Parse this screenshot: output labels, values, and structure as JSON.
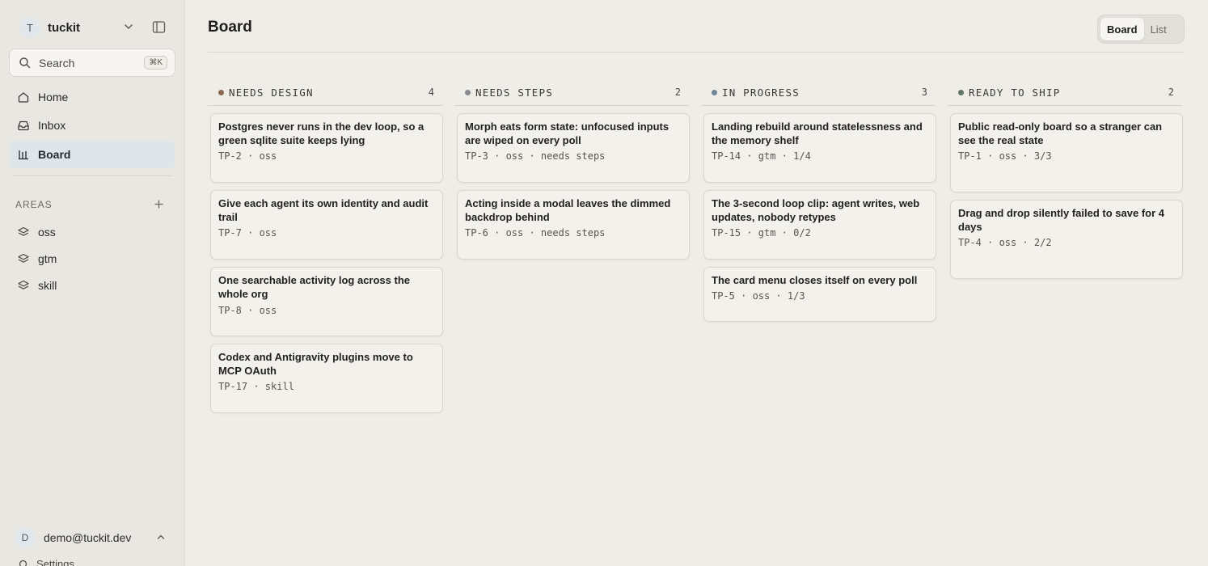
{
  "sidebar": {
    "workspace": {
      "initial": "T",
      "name": "tuckit"
    },
    "search": {
      "label": "Search",
      "shortcut": "⌘K"
    },
    "nav": [
      {
        "label": "Home",
        "icon": "home-icon"
      },
      {
        "label": "Inbox",
        "icon": "inbox-icon"
      },
      {
        "label": "Board",
        "icon": "board-icon",
        "active": true
      }
    ],
    "areas": {
      "label": "AREAS",
      "items": [
        {
          "label": "oss",
          "icon": "layers-icon"
        },
        {
          "label": "gtm",
          "icon": "layers-icon"
        },
        {
          "label": "skill",
          "icon": "layers-icon"
        }
      ]
    },
    "user": {
      "initial": "D",
      "email": "demo@tuckit.dev"
    },
    "settings_label": "Settings"
  },
  "header": {
    "title": "Board",
    "views": [
      {
        "label": "Board",
        "active": true
      },
      {
        "label": "List",
        "active": false
      }
    ]
  },
  "colors": {
    "needs_design": "#8a6a50",
    "needs_steps": "#8b8a93",
    "in_progress": "#6e8595",
    "ready_to_ship": "#5f7266",
    "active_nav": "#dfe6ea"
  },
  "columns": [
    {
      "title": "NEEDS DESIGN",
      "count": "4",
      "cards": [
        {
          "title": "Postgres never runs in the dev loop, so a green sqlite suite keeps lying",
          "meta": "TP-2 · oss"
        },
        {
          "title": "Give each agent its own identity and audit trail",
          "meta": "TP-7 · oss"
        },
        {
          "title": "One searchable activity log across the whole org",
          "meta": "TP-8 · oss"
        },
        {
          "title": "Codex and Antigravity plugins move to MCP OAuth",
          "meta": "TP-17 · skill"
        }
      ]
    },
    {
      "title": "NEEDS STEPS",
      "count": "2",
      "cards": [
        {
          "title": "Morph eats form state: unfocused inputs are wiped on every poll",
          "meta": "TP-3 · oss · needs steps"
        },
        {
          "title": "Acting inside a modal leaves the dimmed backdrop behind",
          "meta": "TP-6 · oss · needs steps"
        }
      ]
    },
    {
      "title": "IN PROGRESS",
      "count": "3",
      "cards": [
        {
          "title": "Landing rebuild around statelessness and the memory shelf",
          "meta": "TP-14 · gtm · 1/4"
        },
        {
          "title": "The 3-second loop clip: agent writes, web updates, nobody retypes",
          "meta": "TP-15 · gtm · 0/2"
        },
        {
          "title": "The card menu closes itself on every poll",
          "meta": "TP-5 · oss · 1/3"
        }
      ]
    },
    {
      "title": "READY TO SHIP",
      "count": "2",
      "cards": [
        {
          "title": "Public read-only board so a stranger can see the real state",
          "meta": "TP-1 · oss · 3/3"
        },
        {
          "title": "Drag and drop silently failed to save for 4 days",
          "meta": "TP-4 · oss · 2/2"
        }
      ]
    }
  ]
}
